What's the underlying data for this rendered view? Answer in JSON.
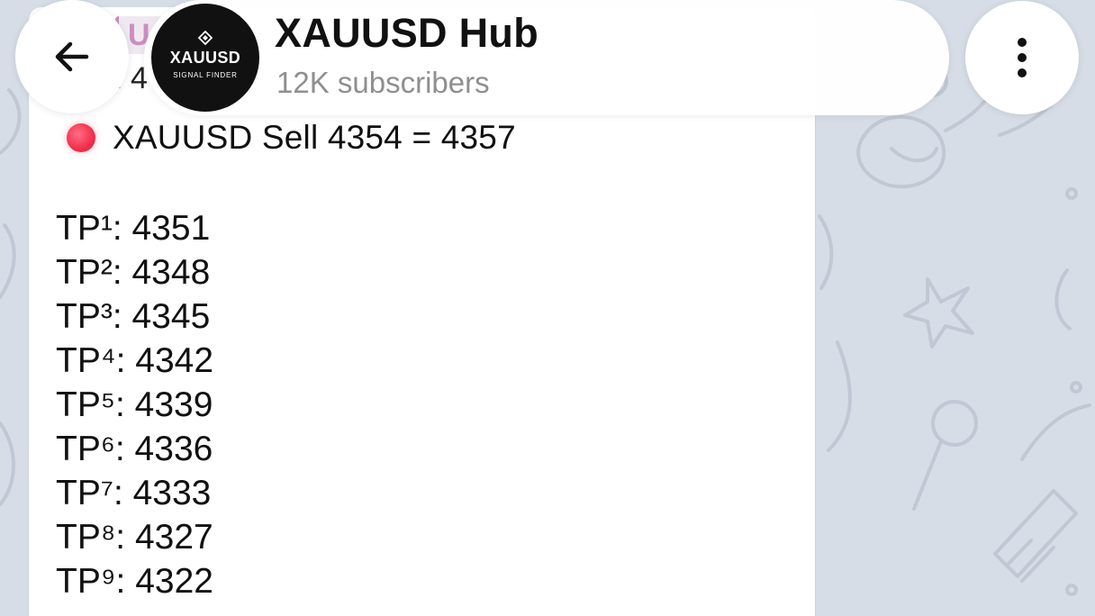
{
  "header": {
    "back_icon": "arrow-left-icon",
    "channel_name": "XAUUSD Hub",
    "subscribers": "12K subscribers",
    "menu_icon": "vertical-dots-icon",
    "avatar": {
      "brand": "XAUUSD",
      "tagline": "SIGNAL FINDER",
      "icon": "diamond-icon"
    }
  },
  "message": {
    "reply_partial_text": "U",
    "reply_partial_sub": "l 4",
    "status_icon": "red-circle-icon",
    "signal": "XAUUSD Sell 4354 = 4357",
    "take_profits": [
      "TP¹: 4351",
      "TP²: 4348",
      "TP³: 4345",
      "TP⁴: 4342",
      "TP⁵: 4339",
      "TP⁶: 4336",
      "TP⁷: 4333",
      "TP⁸: 4327",
      "TP⁹: 4322"
    ]
  },
  "colors": {
    "background": "#d7dde6",
    "bubble": "#ffffff",
    "signal_dot": "#f4334f",
    "subtitle": "#8f8f8f"
  }
}
